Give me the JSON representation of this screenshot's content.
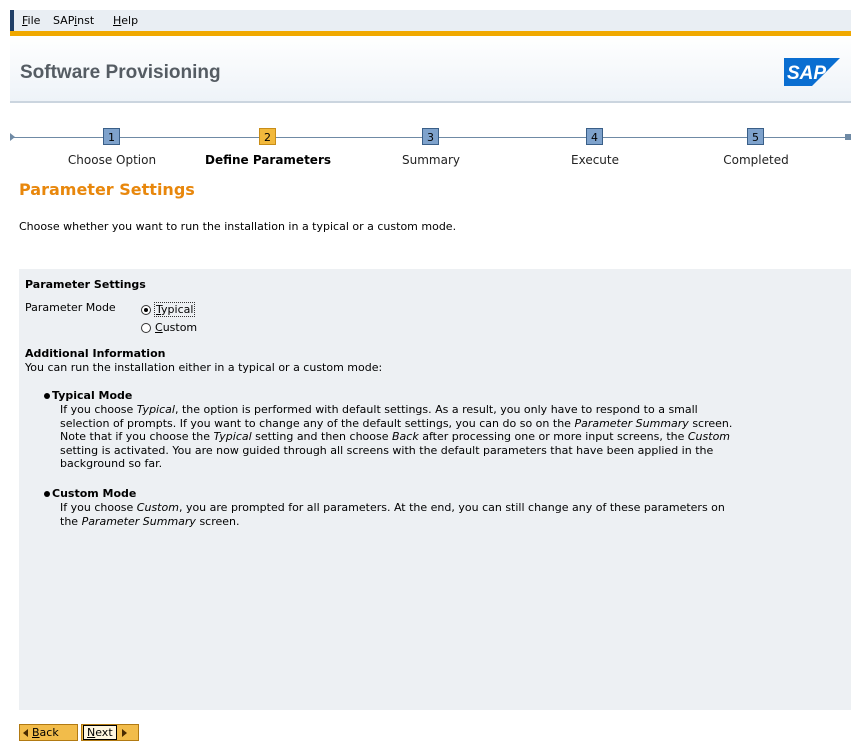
{
  "menu": {
    "file_pre": "",
    "file_mn": "F",
    "file_post": "ile",
    "sapinst_pre": "SAP",
    "sapinst_mn": "i",
    "sapinst_post": "nst",
    "help_pre": "",
    "help_mn": "H",
    "help_post": "elp"
  },
  "header": {
    "title": "Software Provisioning",
    "logo_text": "SAP"
  },
  "roadmap": {
    "steps": [
      {
        "number": "1",
        "label": "Choose Option"
      },
      {
        "number": "2",
        "label": "Define Parameters"
      },
      {
        "number": "3",
        "label": "Summary"
      },
      {
        "number": "4",
        "label": "Execute"
      },
      {
        "number": "5",
        "label": "Completed"
      }
    ],
    "active_step": 2
  },
  "page": {
    "heading": "Parameter Settings",
    "intro": "Choose whether you want to run the installation in a typical or a custom mode."
  },
  "panel": {
    "heading": "Parameter Settings",
    "mode_label": "Parameter Mode",
    "options": [
      {
        "pre": "",
        "mn": "T",
        "post": "ypical",
        "checked": true
      },
      {
        "pre": "",
        "mn": "C",
        "post": "ustom",
        "checked": false
      }
    ],
    "info_heading": "Additional Information",
    "info_text": "You can run the installation either in a typical or a custom mode:",
    "typical": {
      "title": "Typical Mode",
      "l1_a": "If you choose ",
      "l1_b": "Typical",
      "l1_c": ", the option is performed with default settings. As a result, you only have to respond to a small",
      "l2_a": "selection of prompts. If you want to change any of the default settings, you can do so on the ",
      "l2_b": "Parameter Summary",
      "l2_c": " screen.",
      "l3_a": "Note that if you choose the ",
      "l3_b": "Typical",
      "l3_c": " setting and then choose ",
      "l3_d": "Back",
      "l3_e": " after processing one or more input screens, the ",
      "l3_f": "Custom",
      "l4": "setting is activated. You are now guided through all screens with the default parameters that have been applied in the",
      "l5": "background so far."
    },
    "custom": {
      "title": "Custom Mode",
      "l1_a": "If you choose ",
      "l1_b": "Custom",
      "l1_c": ", you are prompted for all parameters. At the end, you can still change any of these parameters on",
      "l2_a": "the ",
      "l2_b": "Parameter Summary",
      "l2_c": " screen."
    }
  },
  "buttons": {
    "back_mn": "B",
    "back_post": "ack",
    "next_mn": "N",
    "next_post": "ext"
  },
  "colors": {
    "accent_orange": "#e8870c",
    "button_orange": "#f2bc4a",
    "step_blue": "#7ea2cc",
    "step_active": "#f2b93c",
    "sap_blue": "#0a6ed1"
  }
}
